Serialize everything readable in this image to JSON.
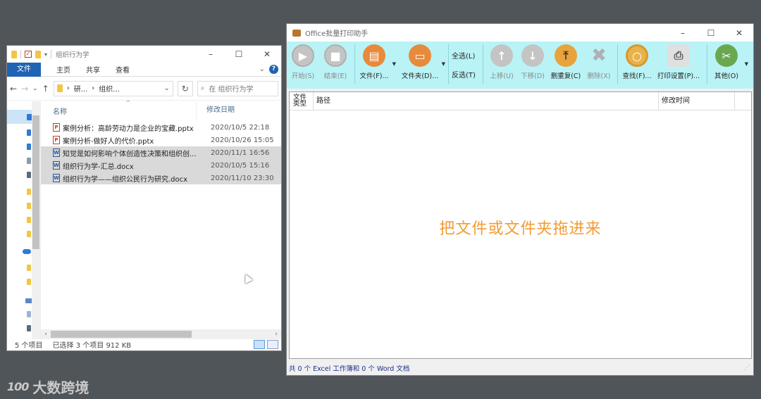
{
  "explorer": {
    "title": "组织行为学",
    "ribbon": {
      "file": "文件",
      "tabs": [
        "主页",
        "共享",
        "查看"
      ]
    },
    "address": {
      "parts": [
        "研...",
        "组织..."
      ]
    },
    "search_placeholder": "在 组织行为学",
    "columns": {
      "name": "名称",
      "date": "修改日期"
    },
    "files": [
      {
        "name": "案例分析：高龄劳动力是企业的宝藏.pptx",
        "date": "2020/10/5 22:18",
        "type": "ppt",
        "selected": false
      },
      {
        "name": "案例分析-做好人的代价.pptx",
        "date": "2020/10/26 15:05",
        "type": "ppt",
        "selected": false
      },
      {
        "name": "知觉是如何影响个体创造性决策和组织创...",
        "date": "2020/11/1 16:56",
        "type": "doc",
        "selected": true
      },
      {
        "name": "组织行为学-汇总.docx",
        "date": "2020/10/5 15:16",
        "type": "doc",
        "selected": true
      },
      {
        "name": "组织行为学——组织公民行为研究.docx",
        "date": "2020/11/10 23:30",
        "type": "doc",
        "selected": true
      }
    ],
    "status": {
      "count": "5 个项目",
      "selection": "已选择 3 个项目  912 KB"
    }
  },
  "printer": {
    "title": "Office批量打印助手",
    "toolbar": {
      "start": "开始(S)",
      "stop": "结束(E)",
      "file": "文件(F)...",
      "folder": "文件夹(D)...",
      "select_all": "全选(L)",
      "invert": "反选(T)",
      "move_up": "上移(U)",
      "move_down": "下移(D)",
      "dedupe": "删重复(C)",
      "delete": "删除(X)",
      "find": "查找(F)...",
      "print_settings": "打印设置(P)...",
      "other": "其他(O)"
    },
    "columns": {
      "type": "文件类型",
      "path": "路径",
      "modified": "修改时间"
    },
    "drop_hint": "把文件或文件夹拖进来",
    "status": "共 0 个 Excel 工作簿和 0 个 Word 文档"
  },
  "colors": {
    "toolbar_bg": "#b9f3f6",
    "drop_hint": "#f39b33",
    "accent": "#1e63b4"
  },
  "watermark": {
    "text": "大数跨境"
  }
}
